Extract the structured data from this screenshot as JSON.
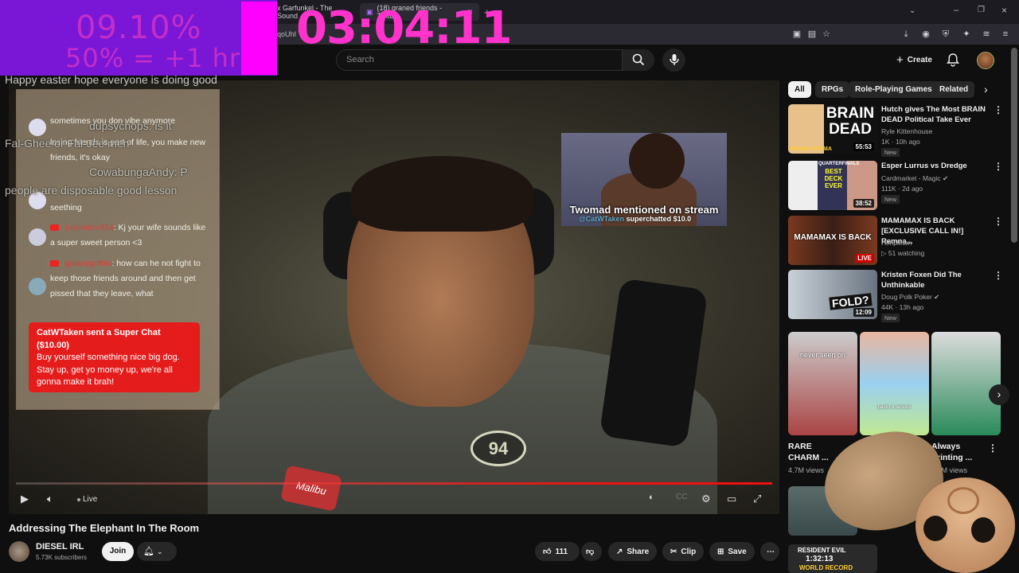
{
  "browser": {
    "tabs": [
      {
        "label": "x Garfunkel - The Sound"
      },
      {
        "label": "(18) graned friends - Twitch"
      }
    ],
    "address_fragment": "qoUhI Y"
  },
  "stream_overlay": {
    "percent": "09.10%",
    "goal": "50% = +1 hr",
    "timer": "03:04:11"
  },
  "header": {
    "search_placeholder": "Search",
    "create_label": "Create"
  },
  "overlay_chat": {
    "easter": "Happy easter hope everyone is doing good",
    "ghost_1": "dupsychops: is it",
    "ghost_2": "Fal-Ghee or Fal-Jee men",
    "ghost_3": "CowabungaAndy: P",
    "ghost_4": "people are disposable good lesson"
  },
  "chat": {
    "messages": [
      {
        "text": "sometimes you don vibe anymore"
      },
      {
        "text": "losing friends is part of life, you make new friends, it's okay"
      },
      {
        "text": "seething"
      },
      {
        "name": "Lexinator414",
        "text": ": Kj your wife sounds like a super sweet person <3"
      },
      {
        "name": "galaxygothic",
        "text": ": how can he not fight to keep those friends around and then get pissed that they leave, what"
      }
    ],
    "superchat": {
      "header": "CatWTaken sent a Super Chat",
      "amount": "($10.00)",
      "body": "Buy yourself something nice big dog. Stay up, get yo money up, we're all gonna make it brah!"
    }
  },
  "inset": {
    "caption": "Twomad mentioned on stream",
    "sub_user": "@CatWTaken",
    "sub_text": "superchatted $10.0"
  },
  "player": {
    "live_label": "Live",
    "jersey_number": "94",
    "hat_text": "Malibu"
  },
  "video": {
    "title": "Addressing The Elephant In The Room",
    "channel": "DIESEL IRL",
    "subscribers": "5.73K subscribers",
    "join_label": "Join",
    "likes": "111",
    "share_label": "Share",
    "clip_label": "Clip",
    "save_label": "Save"
  },
  "chips": [
    "All",
    "RPGs",
    "Role-Playing Games",
    "Related"
  ],
  "recommendations": [
    {
      "title": "Hutch gives The Most BRAIN DEAD Political Take Ever",
      "channel": "Ryle Kittenhouse",
      "meta": "1K · 10h ago",
      "badge": "New",
      "duration": "55:53",
      "thumb_text": "BRAIN DEAD",
      "thumb_sub": "HASAN DRAMA"
    },
    {
      "title": "Esper Lurrus vs Dredge",
      "channel": "Cardmarket - Magic",
      "meta": "111K · 2d ago",
      "badge": "New",
      "duration": "38:52",
      "thumb_text": "BEST DECK EVER",
      "thumb_sub": "QUARTERFINALS"
    },
    {
      "title": "MAMAMAX IS BACK [EXCLUSIVE CALL IN!] Remna...",
      "channel": "Himpleton",
      "meta": "51 watching",
      "badge": "",
      "duration": "LIVE",
      "thumb_text": "MAMAMAX IS BACK",
      "thumb_sub": ""
    },
    {
      "title": "Kristen Foxen Did The Unthinkable",
      "channel": "Doug Polk Poker",
      "meta": "44K · 13h ago",
      "badge": "New",
      "duration": "12:09",
      "thumb_text": "FOLD?",
      "thumb_sub": ""
    }
  ],
  "shorts": [
    {
      "title": "RARE CHARM ...",
      "views": "4.7M views",
      "overlay": "never seen on"
    },
    {
      "title": "n... ...it. ...",
      "views": "",
      "overlay": "packs a serious"
    },
    {
      "title": "Always Printing ...",
      "views": "6.9M views",
      "overlay": ""
    }
  ],
  "bottom_thumb": {
    "text": "RESIDENT EVIL",
    "time": "1:32:13",
    "sub": "WORLD RECORD"
  },
  "colors": {
    "accent_red": "#e11",
    "superchat": "#e51c1c",
    "overlay_purple": "#7a17d6",
    "overlay_pink": "#ff00ff",
    "timer": "#ff33cc"
  }
}
